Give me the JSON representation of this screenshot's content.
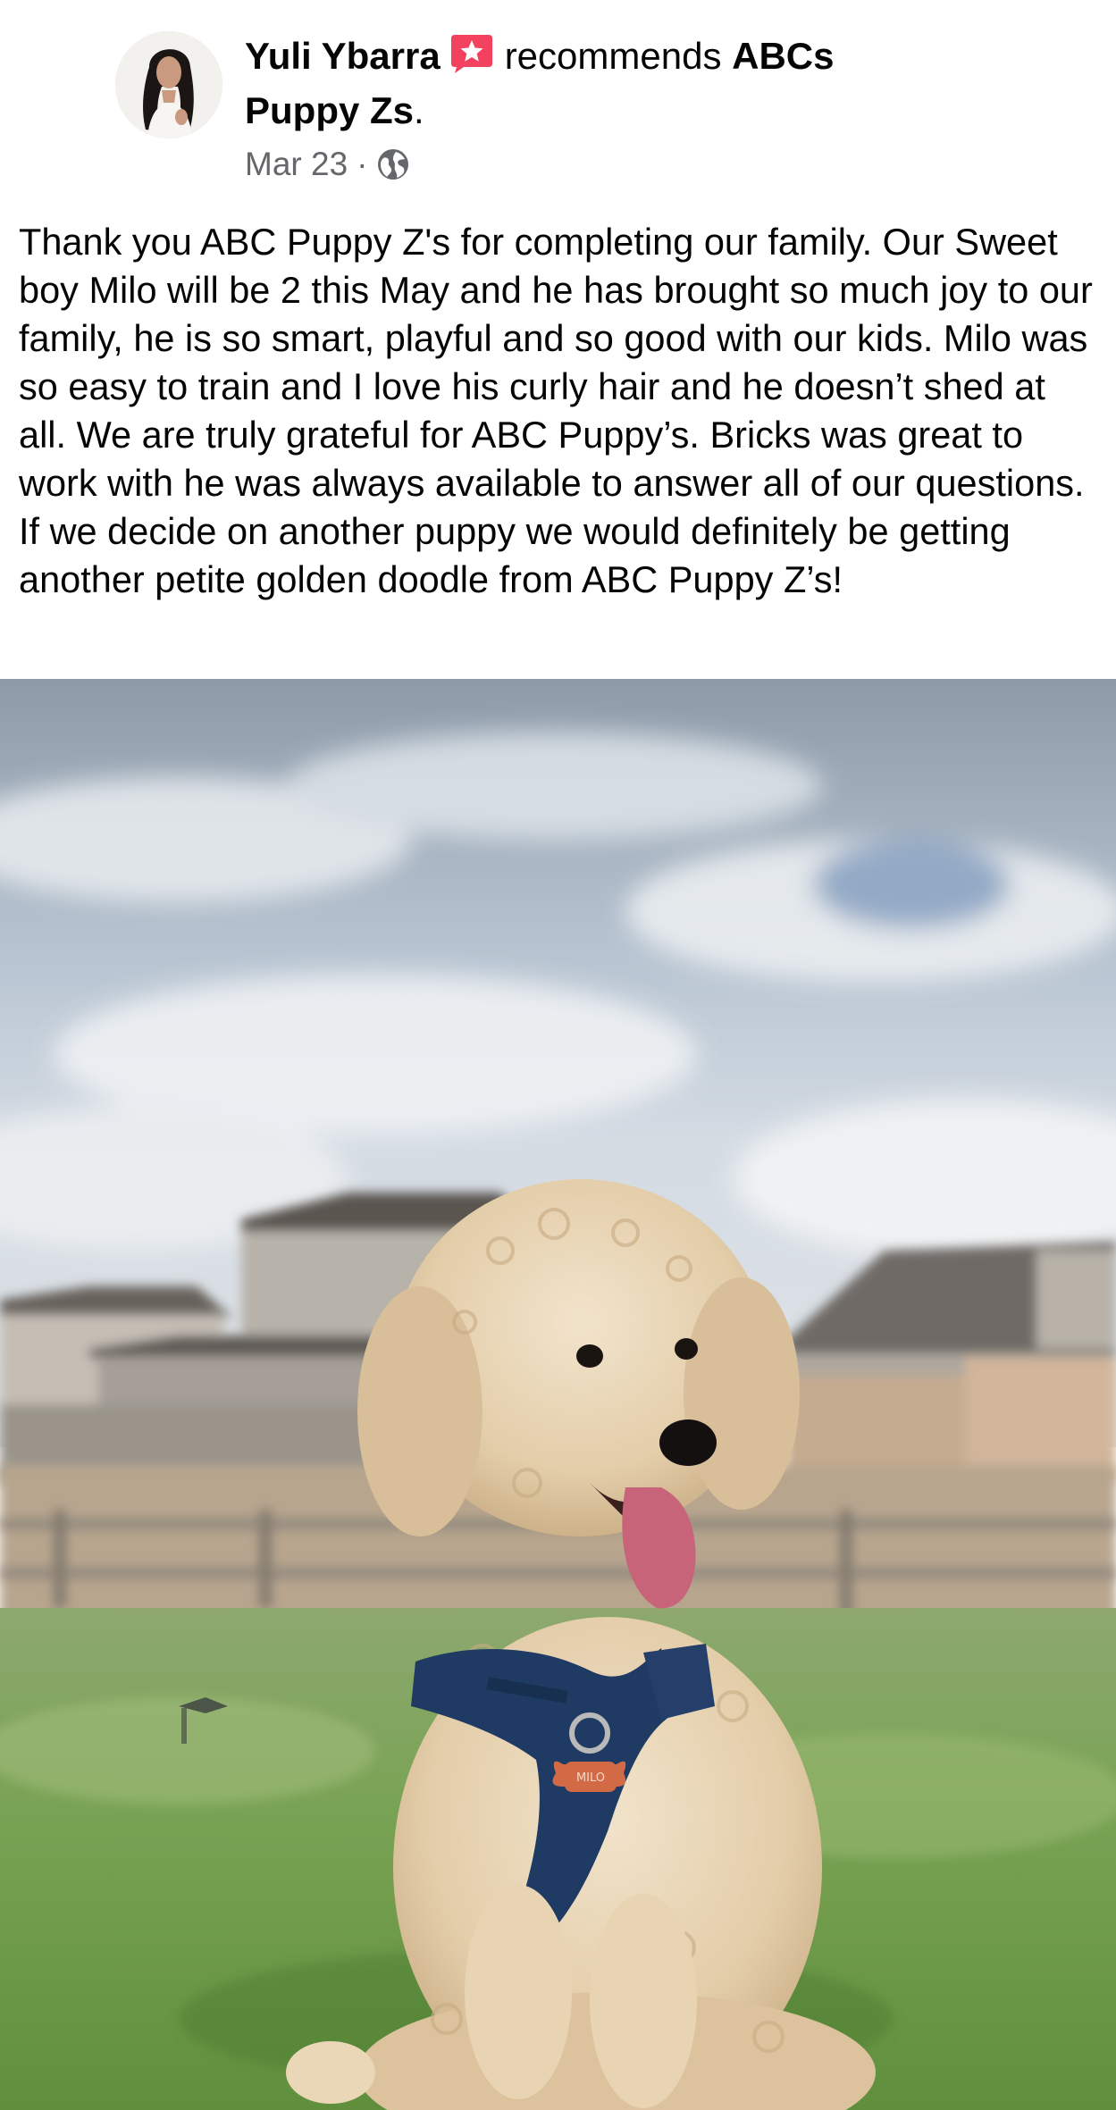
{
  "post": {
    "author_name": "Yuli Ybarra",
    "recommends_text": "recommends",
    "page_name": "ABCs Puppy Zs",
    "page_suffix": ".",
    "date": "Mar 23",
    "separator": "·",
    "body": "Thank you ABC Puppy Z's for completing our family. Our Sweet boy Milo will be 2 this May and he has brought so much joy to our family, he is so smart, playful and so good with our kids. Milo was so easy to train and I love his curly hair and he doesn’t shed at all. We are truly grateful for ABC Puppy’s. Bricks was great to work with he was always available to answer all of our questions. If we decide on another puppy we would definitely be getting another petite golden doodle from ABC Puppy Z’s!",
    "tag_text": "MILO"
  },
  "icons": {
    "recommend": "recommend-star-icon",
    "privacy": "globe-icon"
  },
  "colors": {
    "recommend_badge": "#f3425f",
    "meta_text": "#65676b",
    "text": "#050505"
  }
}
